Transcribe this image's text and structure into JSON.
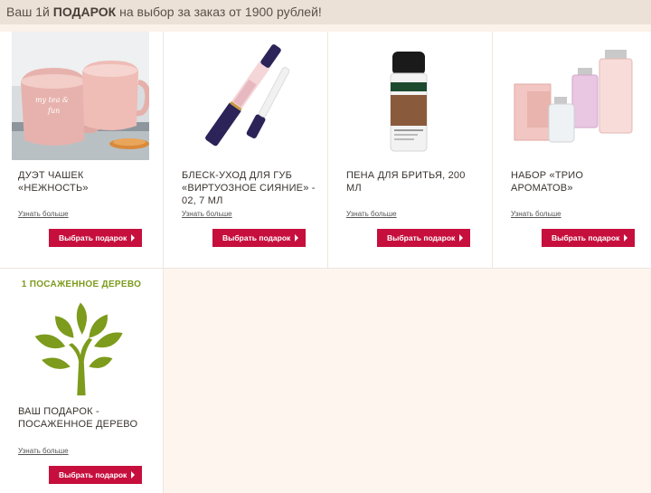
{
  "banner": {
    "prefix": "Ваш 1й",
    "highlight": "ПОДАРОК",
    "suffix": "на выбор за заказ от 1900 рублей!"
  },
  "gifts": [
    {
      "title": "ДУЭТ ЧАШЕК «НЕЖНОСТЬ»",
      "more": "Узнать больше",
      "button": "Выбрать подарок",
      "image": "pink-mugs-image"
    },
    {
      "title": "БЛЕСК-УХОД ДЛЯ ГУБ «ВИРТУОЗНОЕ СИЯНИЕ» - 02, 7 МЛ",
      "more": "Узнать больше",
      "button": "Выбрать подарок",
      "image": "lip-gloss-image"
    },
    {
      "title": "ПЕНА ДЛЯ БРИТЬЯ, 200 МЛ",
      "more": "Узнать больше",
      "button": "Выбрать подарок",
      "image": "shaving-foam-image"
    },
    {
      "title": "НАБОР «ТРИО АРОМАТОВ»",
      "more": "Узнать больше",
      "button": "Выбрать подарок",
      "image": "perfume-trio-image"
    },
    {
      "title": "ВАШ ПОДАРОК - ПОСАЖЕННОЕ ДЕРЕВО",
      "more": "Узнать больше",
      "button": "Выбрать подарок",
      "image": "tree-image",
      "caption": "1 ПОСАЖЕННОЕ ДЕРЕВО"
    }
  ],
  "colors": {
    "button": "#c60f3d",
    "banner_bg": "#ebe1d7",
    "tree_green": "#7d9b1c",
    "page_bg": "#fdf5ee"
  }
}
